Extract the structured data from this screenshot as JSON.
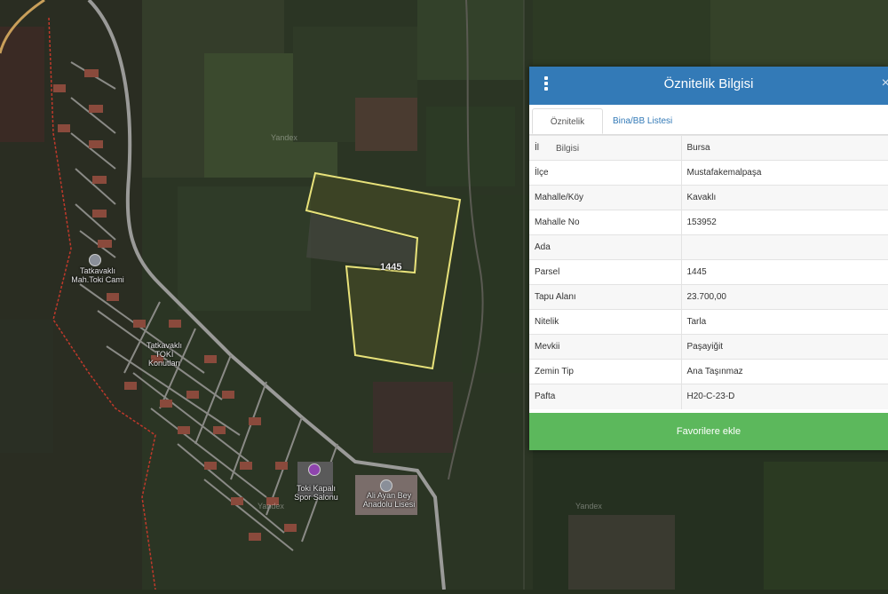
{
  "map": {
    "parcel_label": "1445",
    "labels": {
      "mosque": "Tatkavaklı\nMah.Toki Cami",
      "housing": "Tatkavaklı\nTOKİ\nKonutları",
      "sports_hall": "Toki Kapalı\nSpor Salonu",
      "school": "Ali Ayan Bey\nAnadolu Lisesi"
    },
    "watermarks": [
      "Yandex",
      "Yandex",
      "Yandex"
    ]
  },
  "panel": {
    "title": "Öznitelik Bilgisi",
    "close_label": "×",
    "tabs": [
      {
        "label": "Öznitelik Bilgisi",
        "active": true
      },
      {
        "label": "Bina/BB Listesi",
        "active": false
      }
    ],
    "rows": [
      {
        "key": "İl",
        "value": "Bursa"
      },
      {
        "key": "İlçe",
        "value": "Mustafakemalpaşa"
      },
      {
        "key": "Mahalle/Köy",
        "value": "Kavaklı"
      },
      {
        "key": "Mahalle No",
        "value": "153952"
      },
      {
        "key": "Ada",
        "value": ""
      },
      {
        "key": "Parsel",
        "value": "1445"
      },
      {
        "key": "Tapu Alanı",
        "value": "23.700,00"
      },
      {
        "key": "Nitelik",
        "value": "Tarla"
      },
      {
        "key": "Mevkii",
        "value": "Paşayiğit"
      },
      {
        "key": "Zemin Tip",
        "value": "Ana Taşınmaz"
      },
      {
        "key": "Pafta",
        "value": "H20-C-23-D"
      }
    ],
    "favorite_button": "Favorilere ekle"
  },
  "colors": {
    "header_bg": "#337ab7",
    "button_bg": "#5cb85c",
    "parcel_outline": "#e8e27a",
    "boundary": "#c0392b"
  }
}
